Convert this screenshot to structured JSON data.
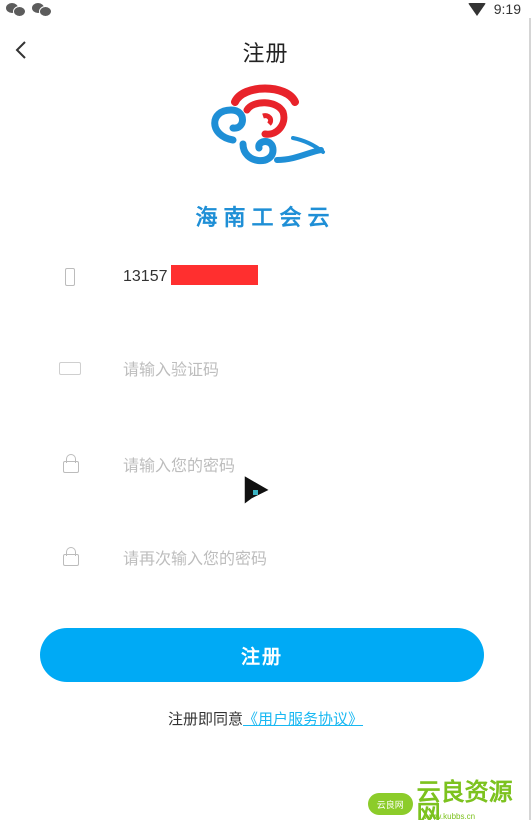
{
  "status_bar": {
    "time": "9:19",
    "left_icons": [
      "wechat-icon",
      "wechat-icon"
    ],
    "right_icons": [
      "wifi-icon"
    ]
  },
  "header": {
    "title": "注册",
    "back_icon": "chevron-left-icon"
  },
  "brand": {
    "name": "海南工会云"
  },
  "form": {
    "phone": {
      "value": "13157",
      "icon": "phone-icon"
    },
    "code": {
      "placeholder": "请输入验证码",
      "icon": "message-icon"
    },
    "password": {
      "placeholder": "请输入您的密码",
      "icon": "lock-icon"
    },
    "password_confirm": {
      "placeholder": "请再次输入您的密码",
      "icon": "lock-icon"
    }
  },
  "submit_label": "注册",
  "agreement": {
    "prefix": "注册即同意",
    "link_text": "《用户服务协议》"
  },
  "watermark": {
    "badge": "云良网",
    "text": "云良资源网",
    "url": "www.kubbs.cn"
  },
  "colors": {
    "primary": "#00aaf5",
    "link": "#19b8f2",
    "logo_red": "#e8232a",
    "logo_blue": "#1f8fd6",
    "redaction": "#ff2f2f"
  }
}
